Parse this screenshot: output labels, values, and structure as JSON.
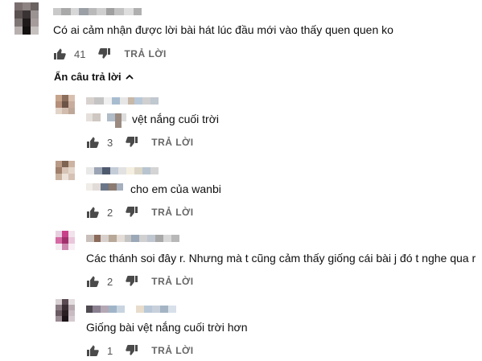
{
  "top_comment": {
    "text": "Có ai cảm nhận được lời bài hát lúc đầu mới vào thấy quen quen ko",
    "likes": "41",
    "reply_label": "TRẢ LỜI"
  },
  "replies_toggle": {
    "label": "Ẩn câu trả lời"
  },
  "replies": [
    {
      "text": "vệt nắng cuối trời",
      "likes": "3",
      "reply_label": "TRẢ LỜI"
    },
    {
      "text": "cho em của wanbi",
      "likes": "2",
      "reply_label": "TRẢ LỜI"
    },
    {
      "text": "Các thánh soi đây r. Nhưng mà t cũng cảm thấy giống cái bài j đó t nghe qua r",
      "likes": "2",
      "reply_label": "TRẢ LỜI"
    },
    {
      "text": "Giống bài vệt nắng cuối trời hơn",
      "likes": "1",
      "reply_label": "TRẢ LỜI"
    }
  ],
  "colors": {
    "text": "#0f0f0f",
    "secondary": "#606060",
    "icon": "#4a4a4a"
  }
}
